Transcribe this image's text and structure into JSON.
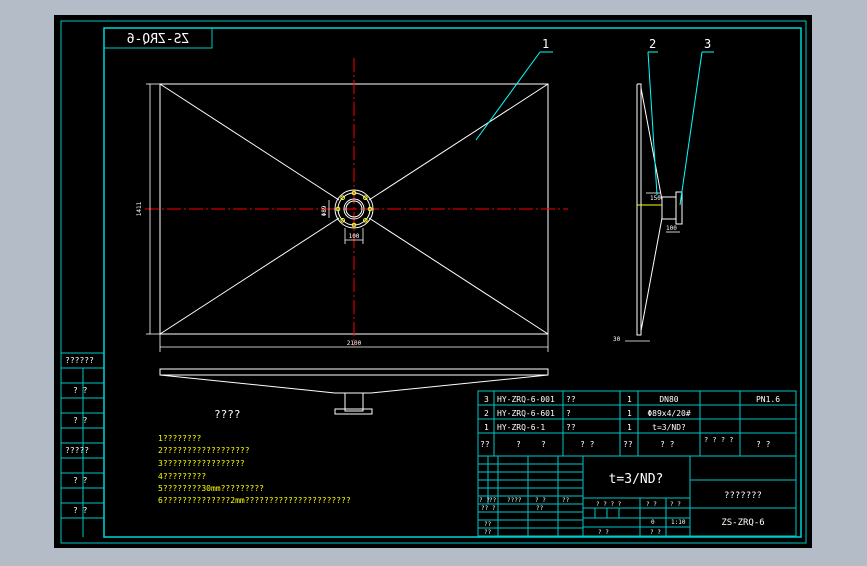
{
  "colors": {
    "background": "#b4bcc8",
    "canvas": "#000000",
    "frame": "#00c8c8",
    "geometry": "#ffffff",
    "centerline": "#ff0000",
    "leader": "#00ffff",
    "text": "#ffffff",
    "dimension": "#ffff00"
  },
  "drawing": {
    "code_mirrored": "ZS-ZRQ-6",
    "balloons": [
      "1",
      "2",
      "3"
    ],
    "dims": {
      "height": "1411",
      "width": "2100",
      "nozzle_w": "Φ89",
      "nozzle_h": "100",
      "side_top": "150",
      "side_bottom": "100",
      "side_thk": "30"
    }
  },
  "notes": {
    "title": "????",
    "lines": [
      "1????????",
      "2??????????????????",
      "3?????????????????",
      "4?????????",
      "5????????30mm?????????",
      "6??????????????2mm??????????????????????"
    ]
  },
  "side_strip": [
    "??????",
    "? ?",
    "? ?",
    "?????",
    "? ?",
    "? ?"
  ],
  "bom": {
    "rows": [
      {
        "no": "3",
        "code": "HY-ZRQ-6-001",
        "name": "??",
        "qty": "1",
        "spec": "DN80",
        "note": "PN1.6"
      },
      {
        "no": "2",
        "code": "HY-ZRQ-6-601",
        "name": "?",
        "qty": "1",
        "spec": "Φ89x4/20#",
        "note": ""
      },
      {
        "no": "1",
        "code": "HY-ZRQ-6-1",
        "name": "??",
        "qty": "1",
        "spec": "t=3/ND?",
        "note": ""
      }
    ],
    "header": [
      "??",
      "?",
      "?",
      "? ?",
      "??",
      "? ?",
      "? ?\n? ?",
      "? ?"
    ]
  },
  "title_block": {
    "material": "t=3/ND?",
    "title": "???????",
    "drawing_no": "ZS-ZRQ-6",
    "sign_rows": [
      "?? ?",
      "??",
      "??",
      "??"
    ],
    "sign_cols": [
      "? ?",
      "????",
      "? ?",
      "??",
      "??"
    ],
    "stage": "? ? ? ?",
    "weight": "? ?",
    "scale_label": "? ?",
    "weight_value": "0",
    "scale_value": "1:10",
    "sheet": "? ?",
    "sheet_of": "? ?"
  }
}
